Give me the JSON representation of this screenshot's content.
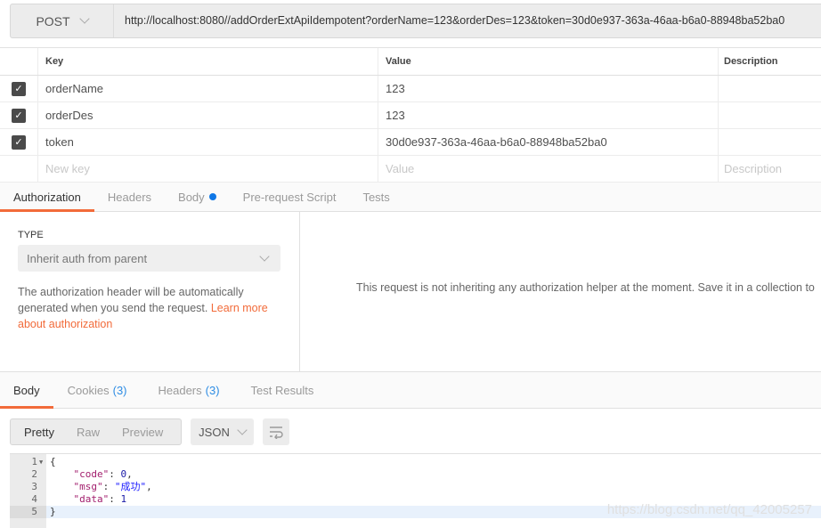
{
  "request": {
    "method": "POST",
    "url": "http://localhost:8080//addOrderExtApiIdempotent?orderName=123&orderDes=123&token=30d0e937-363a-46aa-b6a0-88948ba52ba0"
  },
  "params": {
    "headers": {
      "key": "Key",
      "value": "Value",
      "description": "Description"
    },
    "rows": [
      {
        "key": "orderName",
        "value": "123",
        "checked": true
      },
      {
        "key": "orderDes",
        "value": "123",
        "checked": true
      },
      {
        "key": "token",
        "value": "30d0e937-363a-46aa-b6a0-88948ba52ba0",
        "checked": true
      }
    ],
    "placeholders": {
      "key": "New key",
      "value": "Value",
      "description": "Description"
    }
  },
  "request_tabs": [
    "Authorization",
    "Headers",
    "Body",
    "Pre-request Script",
    "Tests"
  ],
  "auth": {
    "type_label": "TYPE",
    "type_value": "Inherit auth from parent",
    "description": "The authorization header will be automatically generated when you send the request. ",
    "learn_more": "Learn more about authorization",
    "message": "This request is not inheriting any authorization helper at the moment. Save it in a collection to"
  },
  "response_tabs": [
    {
      "label": "Body"
    },
    {
      "label": "Cookies",
      "count": "(3)"
    },
    {
      "label": "Headers",
      "count": "(3)"
    },
    {
      "label": "Test Results"
    }
  ],
  "view": {
    "pretty": "Pretty",
    "raw": "Raw",
    "preview": "Preview",
    "format": "JSON"
  },
  "editor": {
    "line_numbers": [
      "1",
      "2",
      "3",
      "4",
      "5"
    ],
    "lines": {
      "l1": "{",
      "code_key": "\"code\"",
      "code_val": "0",
      "msg_key": "\"msg\"",
      "msg_val": "\"成功\"",
      "data_key": "\"data\"",
      "data_val": "1",
      "l5": "}"
    }
  },
  "watermark": "https://blog.csdn.net/qq_42005257",
  "colors": {
    "accent": "#f26b3a",
    "count": "#2f8de4",
    "body_dot": "#0f77e6"
  }
}
